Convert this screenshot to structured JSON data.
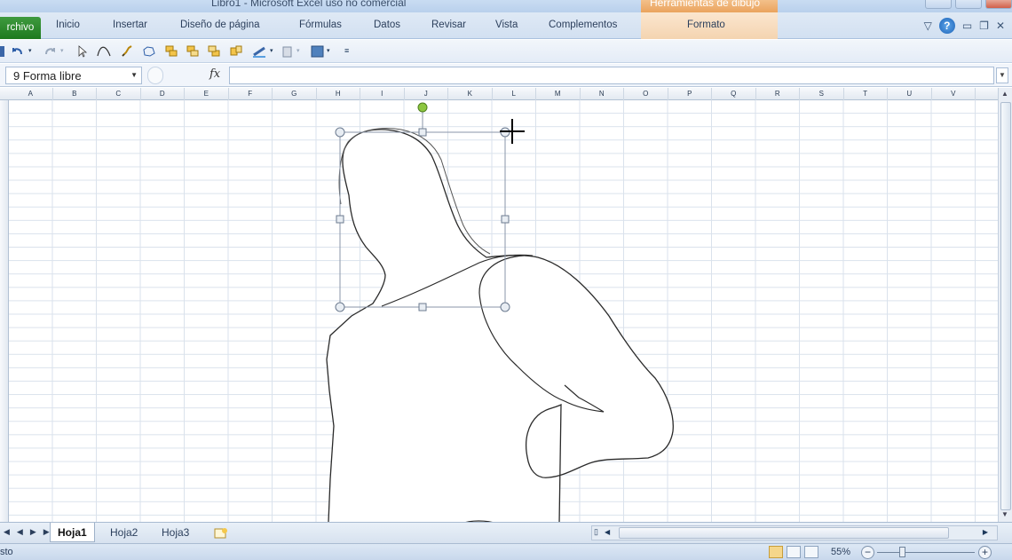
{
  "window": {
    "title": "Libro1  -  Microsoft Excel uso no comercial",
    "context_header": "Herramientas de dibujo"
  },
  "ribbon": {
    "file_tab": "rchivo",
    "tabs": [
      "Inicio",
      "Insertar",
      "Diseño de página",
      "Fórmulas",
      "Datos",
      "Revisar",
      "Vista",
      "Complementos"
    ],
    "format_tab": "Formato",
    "help_label": "?"
  },
  "formula_bar": {
    "name_box": "9 Forma libre",
    "fx_label": "fx",
    "formula_value": ""
  },
  "columns": [
    "A",
    "B",
    "C",
    "D",
    "E",
    "F",
    "G",
    "H",
    "I",
    "J",
    "K",
    "L",
    "M",
    "N",
    "O",
    "P",
    "Q",
    "R",
    "S",
    "T",
    "U",
    "V"
  ],
  "sheets": {
    "tabs": [
      "Hoja1",
      "Hoja2",
      "Hoja3"
    ],
    "active": "Hoja1"
  },
  "status": {
    "text": "sto",
    "zoom": "55%",
    "zoom_minus": "−",
    "zoom_plus": "+"
  },
  "colors": {
    "file_tab": "#1e7a1e",
    "context_tab": "#eaa35d",
    "selection_handle": "#6ab04c"
  },
  "drawing": {
    "shape_type": "freeform",
    "selected": true,
    "icons": [
      "rotate-handle-icon",
      "crosshair-cursor-icon"
    ]
  }
}
